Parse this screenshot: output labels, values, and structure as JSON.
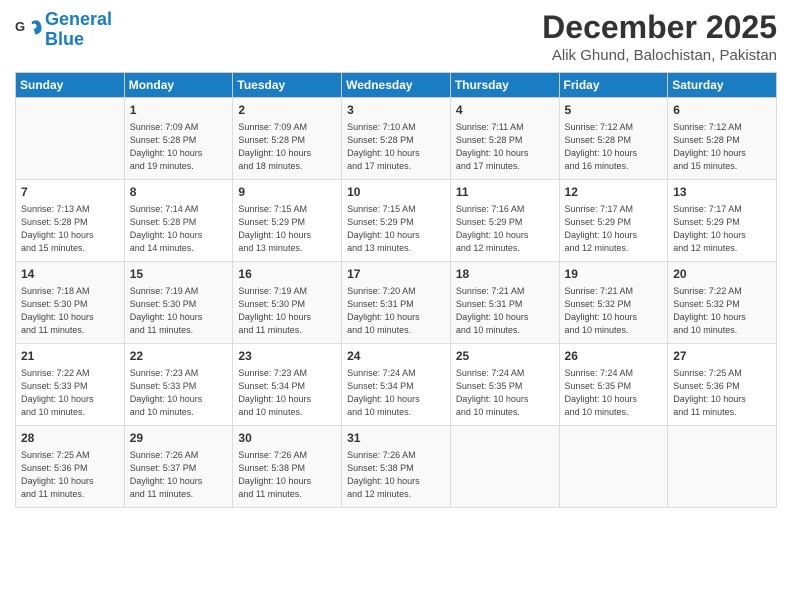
{
  "logo": {
    "line1": "General",
    "line2": "Blue"
  },
  "title": "December 2025",
  "location": "Alik Ghund, Balochistan, Pakistan",
  "weekdays": [
    "Sunday",
    "Monday",
    "Tuesday",
    "Wednesday",
    "Thursday",
    "Friday",
    "Saturday"
  ],
  "weeks": [
    [
      {
        "day": "",
        "info": ""
      },
      {
        "day": "1",
        "info": "Sunrise: 7:09 AM\nSunset: 5:28 PM\nDaylight: 10 hours\nand 19 minutes."
      },
      {
        "day": "2",
        "info": "Sunrise: 7:09 AM\nSunset: 5:28 PM\nDaylight: 10 hours\nand 18 minutes."
      },
      {
        "day": "3",
        "info": "Sunrise: 7:10 AM\nSunset: 5:28 PM\nDaylight: 10 hours\nand 17 minutes."
      },
      {
        "day": "4",
        "info": "Sunrise: 7:11 AM\nSunset: 5:28 PM\nDaylight: 10 hours\nand 17 minutes."
      },
      {
        "day": "5",
        "info": "Sunrise: 7:12 AM\nSunset: 5:28 PM\nDaylight: 10 hours\nand 16 minutes."
      },
      {
        "day": "6",
        "info": "Sunrise: 7:12 AM\nSunset: 5:28 PM\nDaylight: 10 hours\nand 15 minutes."
      }
    ],
    [
      {
        "day": "7",
        "info": "Sunrise: 7:13 AM\nSunset: 5:28 PM\nDaylight: 10 hours\nand 15 minutes."
      },
      {
        "day": "8",
        "info": "Sunrise: 7:14 AM\nSunset: 5:28 PM\nDaylight: 10 hours\nand 14 minutes."
      },
      {
        "day": "9",
        "info": "Sunrise: 7:15 AM\nSunset: 5:29 PM\nDaylight: 10 hours\nand 13 minutes."
      },
      {
        "day": "10",
        "info": "Sunrise: 7:15 AM\nSunset: 5:29 PM\nDaylight: 10 hours\nand 13 minutes."
      },
      {
        "day": "11",
        "info": "Sunrise: 7:16 AM\nSunset: 5:29 PM\nDaylight: 10 hours\nand 12 minutes."
      },
      {
        "day": "12",
        "info": "Sunrise: 7:17 AM\nSunset: 5:29 PM\nDaylight: 10 hours\nand 12 minutes."
      },
      {
        "day": "13",
        "info": "Sunrise: 7:17 AM\nSunset: 5:29 PM\nDaylight: 10 hours\nand 12 minutes."
      }
    ],
    [
      {
        "day": "14",
        "info": "Sunrise: 7:18 AM\nSunset: 5:30 PM\nDaylight: 10 hours\nand 11 minutes."
      },
      {
        "day": "15",
        "info": "Sunrise: 7:19 AM\nSunset: 5:30 PM\nDaylight: 10 hours\nand 11 minutes."
      },
      {
        "day": "16",
        "info": "Sunrise: 7:19 AM\nSunset: 5:30 PM\nDaylight: 10 hours\nand 11 minutes."
      },
      {
        "day": "17",
        "info": "Sunrise: 7:20 AM\nSunset: 5:31 PM\nDaylight: 10 hours\nand 10 minutes."
      },
      {
        "day": "18",
        "info": "Sunrise: 7:21 AM\nSunset: 5:31 PM\nDaylight: 10 hours\nand 10 minutes."
      },
      {
        "day": "19",
        "info": "Sunrise: 7:21 AM\nSunset: 5:32 PM\nDaylight: 10 hours\nand 10 minutes."
      },
      {
        "day": "20",
        "info": "Sunrise: 7:22 AM\nSunset: 5:32 PM\nDaylight: 10 hours\nand 10 minutes."
      }
    ],
    [
      {
        "day": "21",
        "info": "Sunrise: 7:22 AM\nSunset: 5:33 PM\nDaylight: 10 hours\nand 10 minutes."
      },
      {
        "day": "22",
        "info": "Sunrise: 7:23 AM\nSunset: 5:33 PM\nDaylight: 10 hours\nand 10 minutes."
      },
      {
        "day": "23",
        "info": "Sunrise: 7:23 AM\nSunset: 5:34 PM\nDaylight: 10 hours\nand 10 minutes."
      },
      {
        "day": "24",
        "info": "Sunrise: 7:24 AM\nSunset: 5:34 PM\nDaylight: 10 hours\nand 10 minutes."
      },
      {
        "day": "25",
        "info": "Sunrise: 7:24 AM\nSunset: 5:35 PM\nDaylight: 10 hours\nand 10 minutes."
      },
      {
        "day": "26",
        "info": "Sunrise: 7:24 AM\nSunset: 5:35 PM\nDaylight: 10 hours\nand 10 minutes."
      },
      {
        "day": "27",
        "info": "Sunrise: 7:25 AM\nSunset: 5:36 PM\nDaylight: 10 hours\nand 11 minutes."
      }
    ],
    [
      {
        "day": "28",
        "info": "Sunrise: 7:25 AM\nSunset: 5:36 PM\nDaylight: 10 hours\nand 11 minutes."
      },
      {
        "day": "29",
        "info": "Sunrise: 7:26 AM\nSunset: 5:37 PM\nDaylight: 10 hours\nand 11 minutes."
      },
      {
        "day": "30",
        "info": "Sunrise: 7:26 AM\nSunset: 5:38 PM\nDaylight: 10 hours\nand 11 minutes."
      },
      {
        "day": "31",
        "info": "Sunrise: 7:26 AM\nSunset: 5:38 PM\nDaylight: 10 hours\nand 12 minutes."
      },
      {
        "day": "",
        "info": ""
      },
      {
        "day": "",
        "info": ""
      },
      {
        "day": "",
        "info": ""
      }
    ]
  ]
}
